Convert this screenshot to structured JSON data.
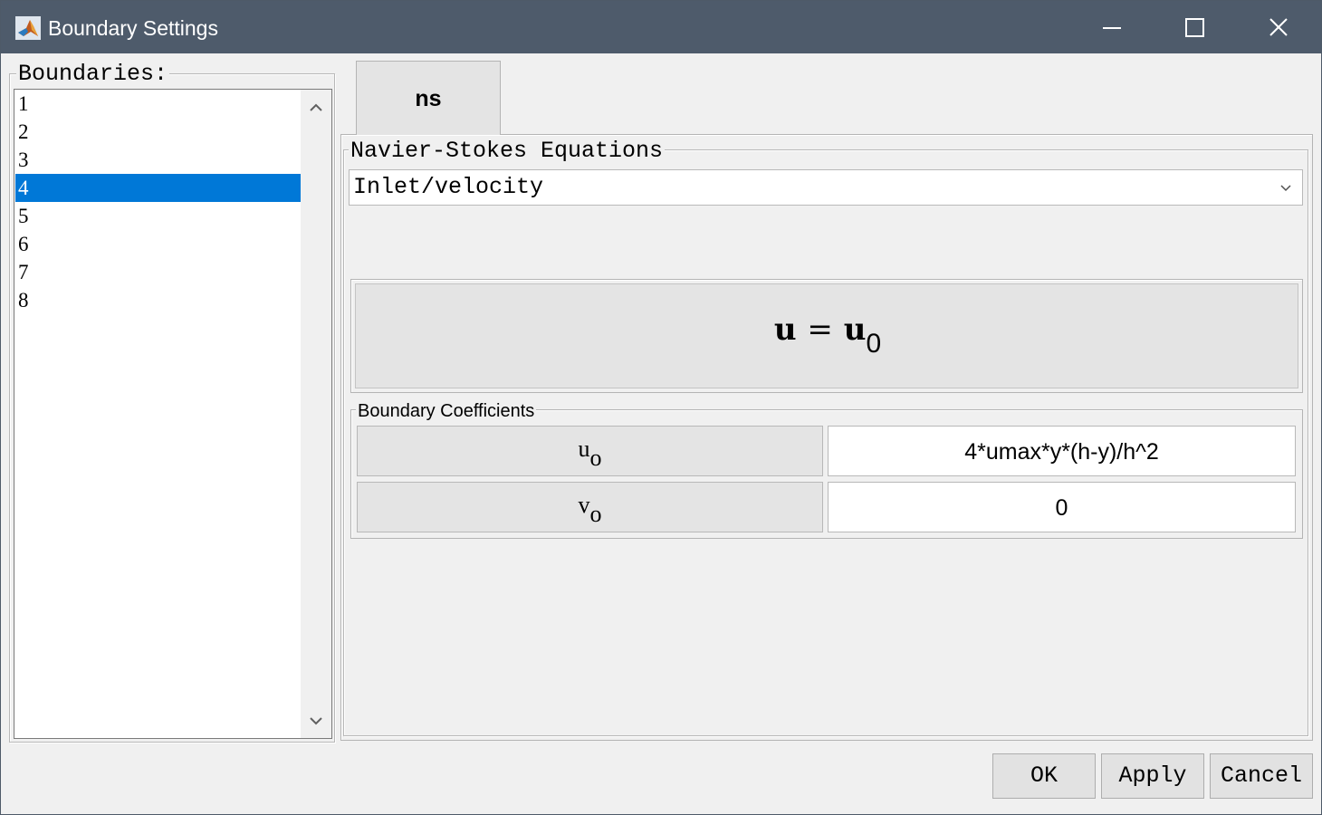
{
  "window": {
    "title": "Boundary Settings"
  },
  "boundaries": {
    "label": "Boundaries:",
    "items": [
      "1",
      "2",
      "3",
      "4",
      "5",
      "6",
      "7",
      "8"
    ],
    "selected": "4"
  },
  "tab": {
    "label": "ns"
  },
  "equations": {
    "group_label": "Navier-Stokes Equations",
    "condition_selected": "Inlet/velocity",
    "equation_lhs": "u",
    "equation_eq": "=",
    "equation_rhs": "u",
    "equation_sub": "0"
  },
  "coefficients": {
    "group_label": "Boundary Coefficients",
    "rows": [
      {
        "symbol": "u",
        "subscript": "o",
        "value": "4*umax*y*(h-y)/h^2"
      },
      {
        "symbol": "v",
        "subscript": "o",
        "value": "0"
      }
    ]
  },
  "buttons": {
    "ok": "OK",
    "apply": "Apply",
    "cancel": "Cancel"
  },
  "colors": {
    "titlebar": "#4e5b6b",
    "selection": "#0078d7"
  }
}
